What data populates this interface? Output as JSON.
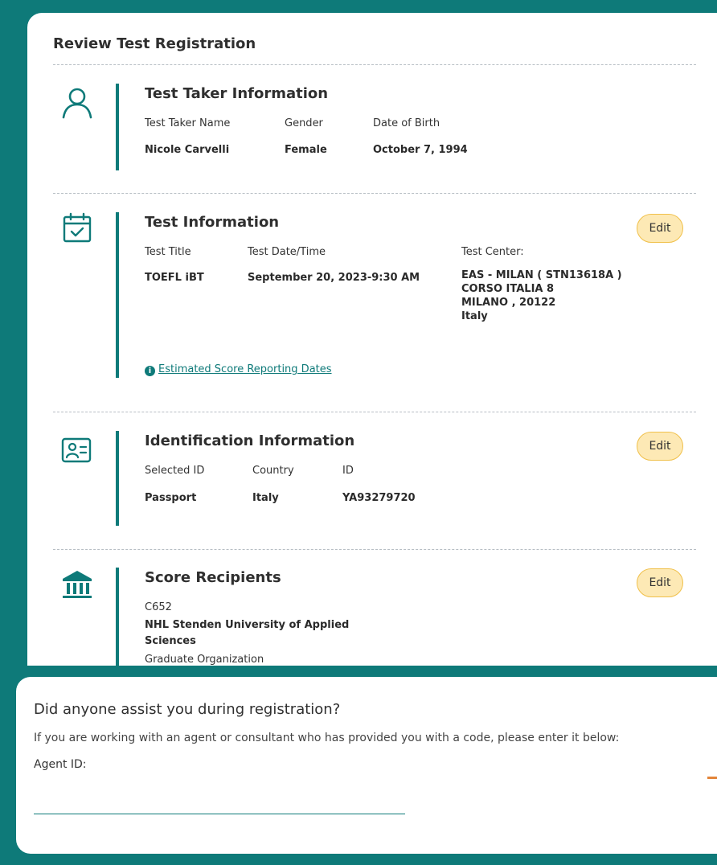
{
  "page": {
    "title": "Review Test Registration"
  },
  "test_taker": {
    "section_title": "Test Taker Information",
    "labels": {
      "name": "Test Taker Name",
      "gender": "Gender",
      "dob": "Date of Birth"
    },
    "values": {
      "name": "Nicole Carvelli",
      "gender": "Female",
      "dob": "October 7, 1994"
    },
    "icon": "person-icon"
  },
  "test_info": {
    "section_title": "Test Information",
    "edit_label": "Edit",
    "labels": {
      "title": "Test Title",
      "datetime": "Test Date/Time",
      "center": "Test Center:"
    },
    "values": {
      "title": "TOEFL iBT",
      "datetime": "September 20, 2023-9:30 AM",
      "center_line1": "EAS - MILAN ( STN13618A )",
      "center_line2": "CORSO ITALIA 8",
      "center_line3": "MILANO , 20122",
      "center_line4": "Italy"
    },
    "score_dates_link": "Estimated Score Reporting Dates",
    "icon": "calendar-check-icon"
  },
  "identification": {
    "section_title": "Identification Information",
    "edit_label": "Edit",
    "labels": {
      "selected_id": "Selected ID",
      "country": "Country",
      "id": "ID"
    },
    "values": {
      "selected_id": "Passport",
      "country": "Italy",
      "id": "YA93279720"
    },
    "icon": "id-card-icon"
  },
  "score_recipients": {
    "section_title": "Score Recipients",
    "edit_label": "Edit",
    "code": "C652",
    "name_line1": "NHL Stenden University of Applied",
    "name_line2": "Sciences",
    "type": "Graduate Organization",
    "icon": "institution-icon"
  },
  "assist": {
    "title": "Did anyone assist you during registration?",
    "description": "If you are working with an agent or consultant who has provided you with a code, please enter it below:",
    "agent_label": "Agent ID:",
    "agent_value": "",
    "agent_placeholder": ""
  },
  "colors": {
    "primary": "#0e7a79",
    "edit_bg": "#fde9b5",
    "edit_border": "#f0c04a"
  }
}
